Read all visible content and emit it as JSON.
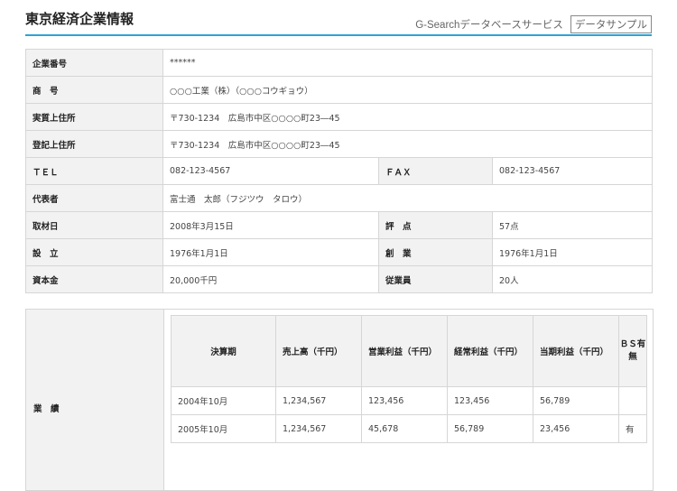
{
  "header": {
    "title": "東京経済企業情報",
    "service": "G-Searchデータベースサービス",
    "sample_label": "データサンプル"
  },
  "info": {
    "company_no_label": "企業番号",
    "company_no": "******",
    "name_label": "商　号",
    "name": "○○○工業（株）（○○○コウギョウ）",
    "real_address_label": "実質上住所",
    "real_address": "〒730-1234　広島市中区○○○○町23―45",
    "reg_address_label": "登記上住所",
    "reg_address": "〒730-1234　広島市中区○○○○町23―45",
    "tel_label": "ＴＥＬ",
    "tel": "082-123-4567",
    "fax_label": "ＦＡＸ",
    "fax": "082-123-4567",
    "rep_label": "代表者",
    "rep": "富士通　太郎（フジツウ　タロウ）",
    "interview_label": "取材日",
    "interview": "2008年3月15日",
    "score_label": "評　点",
    "score": "57点",
    "established_label": "設　立",
    "established": "1976年1月1日",
    "founded_label": "創　業",
    "founded": "1976年1月1日",
    "capital_label": "資本金",
    "capital": "20,000千円",
    "employees_label": "従業員",
    "employees": "20人"
  },
  "performance": {
    "label": "業　績",
    "headers": [
      "決算期",
      "売上高（千円）",
      "営業利益（千円）",
      "経常利益（千円）",
      "当期利益（千円）",
      "ＢＳ有無"
    ],
    "rows": [
      [
        "2004年10月",
        "1,234,567",
        "123,456",
        "123,456",
        "56,789",
        ""
      ],
      [
        "2005年10月",
        "1,234,567",
        "45,678",
        "56,789",
        "23,456",
        "有"
      ]
    ]
  }
}
